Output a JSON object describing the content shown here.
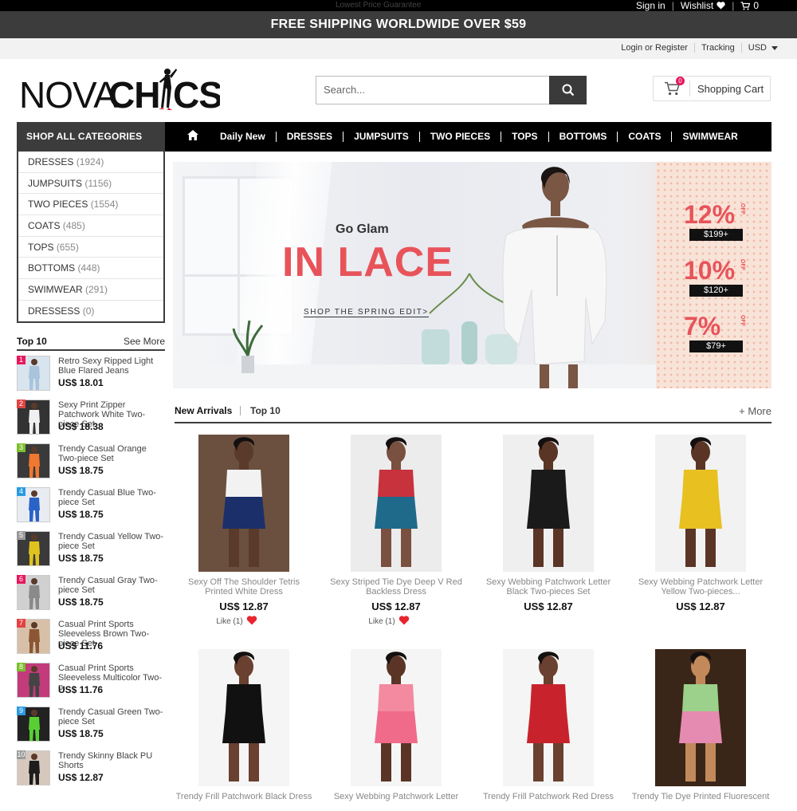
{
  "topbar": {
    "lowest_price": "Lowest Price Guarantee",
    "signin": "Sign in",
    "wishlist": "Wishlist",
    "cart_count": "0"
  },
  "shipping_banner": "FREE SHIPPING WORLDWIDE OVER $59",
  "utility": {
    "login": "Login or Register",
    "tracking": "Tracking",
    "currency": "USD"
  },
  "logo": {
    "text_a": "NOVA",
    "text_b": "CHICS",
    "alt": "NOVACHICS"
  },
  "search": {
    "placeholder": "Search..."
  },
  "cart": {
    "label": "Shopping Cart",
    "count": "0"
  },
  "categories": {
    "title": "SHOP ALL CATEGORIES",
    "items": [
      {
        "label": "DRESSES",
        "count": "(1924)"
      },
      {
        "label": "JUMPSUITS",
        "count": "(1156)"
      },
      {
        "label": "TWO PIECES",
        "count": "(1554)"
      },
      {
        "label": "COATS",
        "count": "(485)"
      },
      {
        "label": "TOPS",
        "count": "(655)"
      },
      {
        "label": "BOTTOMS",
        "count": "(448)"
      },
      {
        "label": "SWIMWEAR",
        "count": "(291)"
      },
      {
        "label": "DRESSESS",
        "count": "(0)"
      }
    ]
  },
  "nav": {
    "items": [
      "Daily New",
      "DRESSES",
      "JUMPSUITS",
      "TWO PIECES",
      "TOPS",
      "BOTTOMS",
      "COATS",
      "SWIMWEAR"
    ]
  },
  "banner": {
    "kicker": "Go Glam",
    "headline": "IN LACE",
    "cta": "SHOP THE SPRING EDIT>",
    "offers": [
      {
        "pct": "12%",
        "word": "OFF",
        "threshold": "$199+"
      },
      {
        "pct": "10%",
        "word": "OFF",
        "threshold": "$120+"
      },
      {
        "pct": "7%",
        "word": "OFF",
        "threshold": "$79+"
      }
    ]
  },
  "top10": {
    "title": "Top 10",
    "see_more": "See More",
    "items": [
      {
        "rank": "1",
        "name": "Retro Sexy Ripped Light Blue Flared Jeans",
        "price": "US$ 18.01",
        "color": "#e8175d"
      },
      {
        "rank": "2",
        "name": "Sexy Print Zipper Patchwork White Two-piece Set",
        "price": "US$ 18.38",
        "color": "#e34242"
      },
      {
        "rank": "3",
        "name": "Trendy Casual Orange Two-piece Set",
        "price": "US$ 18.75",
        "color": "#7cbf2e"
      },
      {
        "rank": "4",
        "name": "Trendy Casual Blue Two-piece Set",
        "price": "US$ 18.75",
        "color": "#2b9be0"
      },
      {
        "rank": "5",
        "name": "Trendy Casual Yellow Two-piece Set",
        "price": "US$ 18.75",
        "color": "#9a9a9a"
      },
      {
        "rank": "6",
        "name": "Trendy Casual Gray Two-piece Set",
        "price": "US$ 18.75",
        "color": "#e8175d"
      },
      {
        "rank": "7",
        "name": "Casual Print Sports Sleeveless Brown Two-piece Set",
        "price": "US$ 11.76",
        "color": "#e34242"
      },
      {
        "rank": "8",
        "name": "Casual Print Sports Sleeveless Multicolor Two-p...",
        "price": "US$ 11.76",
        "color": "#7cbf2e"
      },
      {
        "rank": "9",
        "name": "Trendy Casual Green Two-piece Set",
        "price": "US$ 18.75",
        "color": "#2b9be0"
      },
      {
        "rank": "10",
        "name": "Trendy Skinny Black PU Shorts",
        "price": "US$ 12.87",
        "color": "#9a9a9a"
      }
    ]
  },
  "arrivals": {
    "tab_new": "New Arrivals",
    "tab_top": "Top 10",
    "more": "+ More",
    "products": [
      {
        "name": "Sexy Off The Shoulder Tetris Printed White Dress",
        "price": "US$ 12.87",
        "like": "Like (1)"
      },
      {
        "name": "Sexy Striped Tie Dye Deep V Red Backless Dress",
        "price": "US$ 12.87",
        "like": "Like (1)"
      },
      {
        "name": "Sexy Webbing Patchwork Letter Black Two-pieces Set",
        "price": "US$ 12.87"
      },
      {
        "name": "Sexy Webbing Patchwork Letter Yellow Two-pieces...",
        "price": "US$ 12.87"
      },
      {
        "name": "Trendy Frill Patchwork Black Dress"
      },
      {
        "name": "Sexy Webbing Patchwork Letter"
      },
      {
        "name": "Trendy Frill Patchwork Red Dress"
      },
      {
        "name": "Trendy Tie Dye Printed Fluorescent"
      }
    ]
  }
}
